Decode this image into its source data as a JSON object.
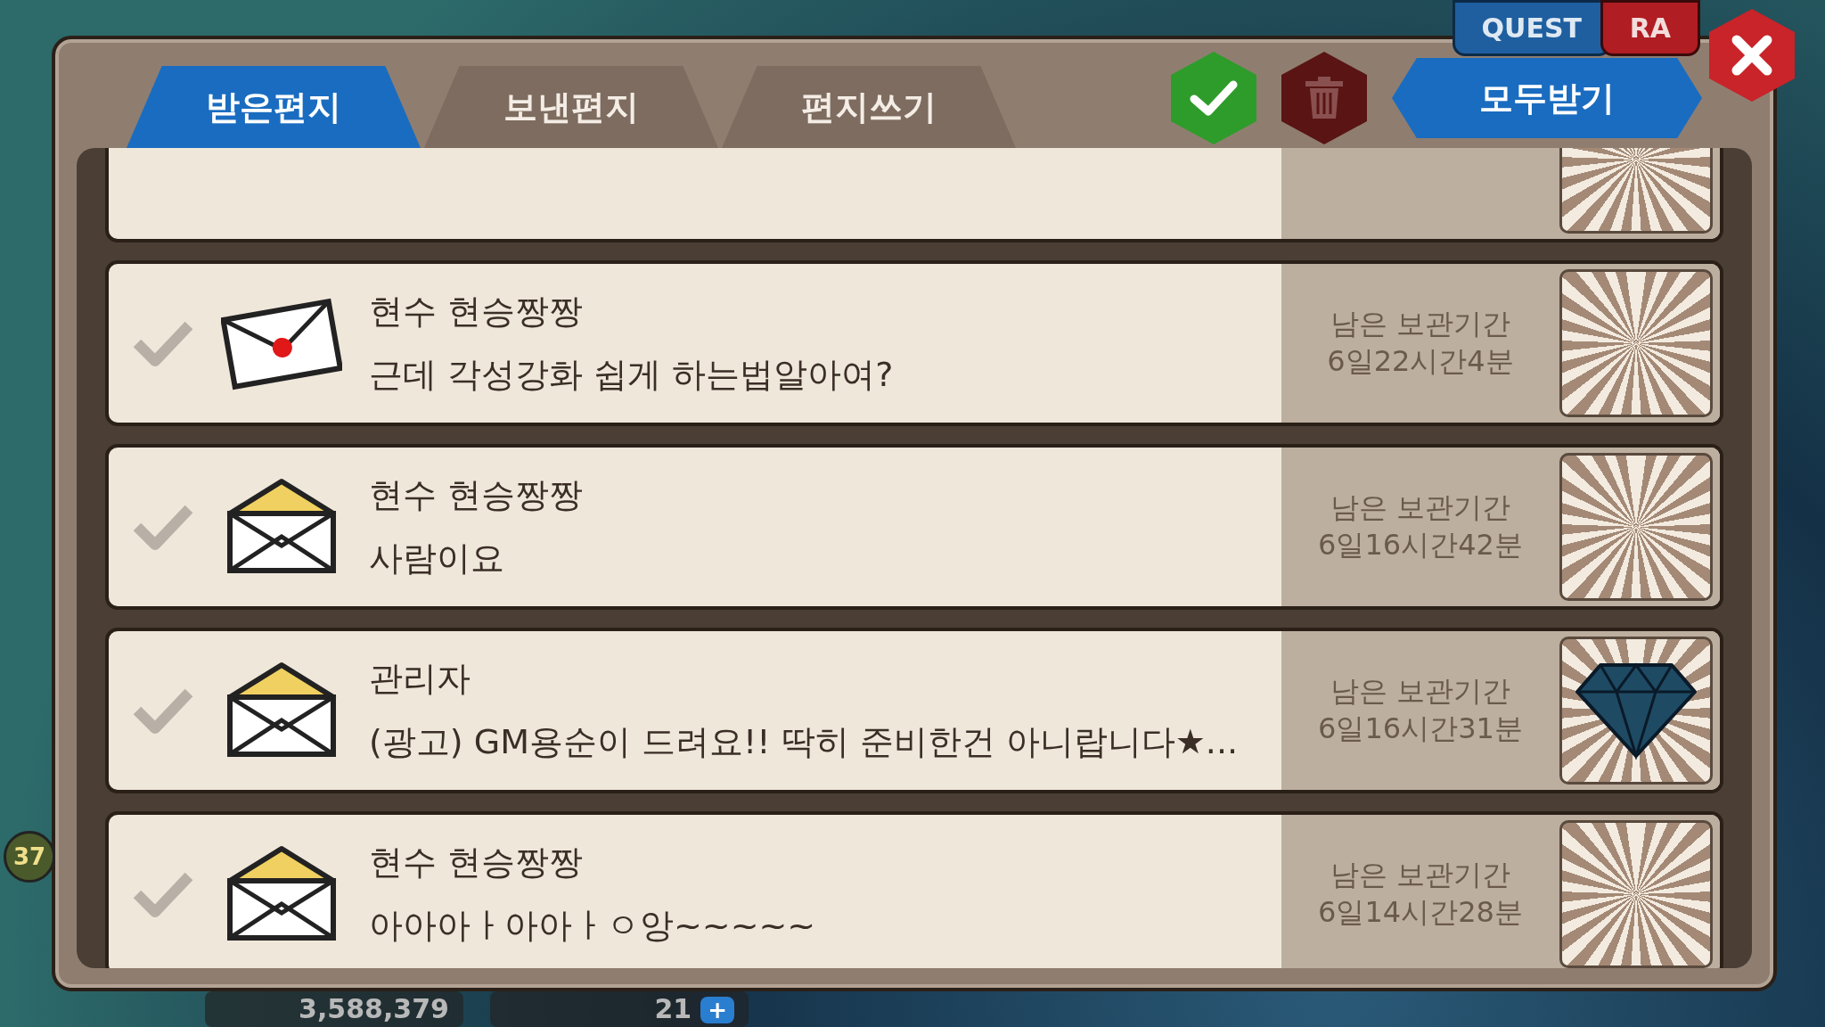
{
  "hud": {
    "quest": "QUEST",
    "raid": "RA",
    "level": "37",
    "gold": "3,588,379",
    "gems": "21",
    "gem_add": "+"
  },
  "tabs": [
    {
      "label": "받은편지",
      "selected": true
    },
    {
      "label": "보낸편지",
      "selected": false
    },
    {
      "label": "편지쓰기",
      "selected": false
    }
  ],
  "accept_all": "모두받기",
  "messages": [
    {
      "checked": false,
      "envelope": {
        "kind": "sealed"
      },
      "sender": "현수 현승짱짱",
      "body": "근데 각성강화 쉽게 하는법알아여?",
      "expiry_label": "남은 보관기간",
      "expiry": "6일22시간4분"
    },
    {
      "checked": false,
      "envelope": {
        "kind": "open"
      },
      "sender": "현수 현승짱짱",
      "body": "사람이요",
      "expiry_label": "남은 보관기간",
      "expiry": "6일16시간42분"
    },
    {
      "checked": false,
      "envelope": {
        "kind": "open"
      },
      "sender": "관리자",
      "body": "(광고) GM용순이 드려요!! 딱히 준비한건 아니랍니다★...",
      "expiry_label": "남은 보관기간",
      "expiry": "6일16시간31분",
      "reward": {
        "kind": "diamond"
      }
    },
    {
      "checked": false,
      "envelope": {
        "kind": "open"
      },
      "sender": "현수 현승짱짱",
      "body": "아아아ㅏ아아ㅏㅇ앙~~~~~",
      "expiry_label": "남은 보관기간",
      "expiry": "6일14시간28분"
    }
  ]
}
